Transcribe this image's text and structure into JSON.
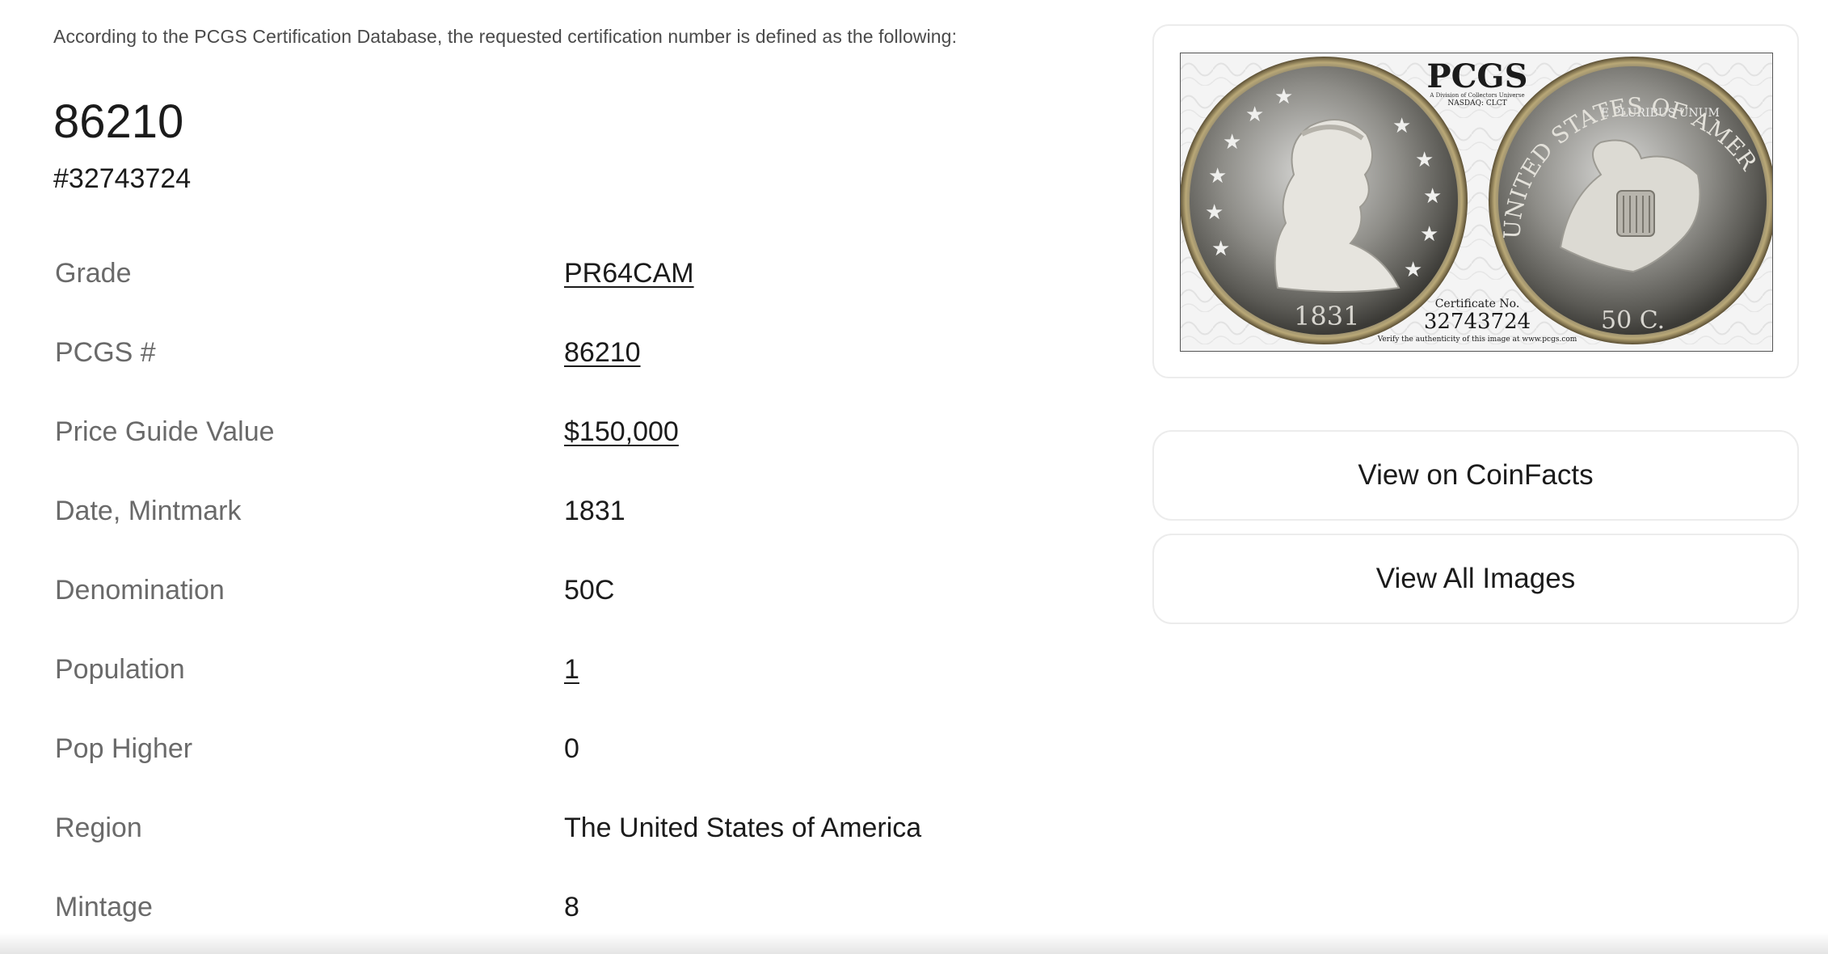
{
  "intro_text": "According to the PCGS Certification Database, the requested certification number is defined as the following:",
  "cert": {
    "number": "86210",
    "id": "#32743724"
  },
  "details": [
    {
      "label": "Grade",
      "value": "PR64CAM",
      "link": true
    },
    {
      "label": "PCGS #",
      "value": "86210",
      "link": true
    },
    {
      "label": "Price Guide Value",
      "value": "$150,000",
      "link": true
    },
    {
      "label": "Date, Mintmark",
      "value": "1831",
      "link": false
    },
    {
      "label": "Denomination",
      "value": "50C",
      "link": false
    },
    {
      "label": "Population",
      "value": "1",
      "link": true
    },
    {
      "label": "Pop Higher",
      "value": "0",
      "link": false
    },
    {
      "label": "Region",
      "value": "The United States of America",
      "link": false
    },
    {
      "label": "Mintage",
      "value": "8",
      "link": false
    }
  ],
  "coin_image": {
    "brand": "PCGS",
    "brand_sub1": "A Division of Collectors Universe",
    "brand_sub2": "NASDAQ: CLCT",
    "obverse_date": "1831",
    "reverse_denom": "50 C.",
    "reverse_legend": "UNITED STATES OF AMERICA",
    "reverse_motto": "E PLURIBUS UNUM",
    "cert_label": "Certificate No.",
    "cert_number": "32743724",
    "verify_text": "Verify the authenticity of this image at www.pcgs.com"
  },
  "buttons": {
    "coinfacts": "View on CoinFacts",
    "all_images": "View All Images"
  },
  "colors": {
    "text": "#1b1b1b",
    "label": "#6a6a6a",
    "border": "#ececec"
  }
}
